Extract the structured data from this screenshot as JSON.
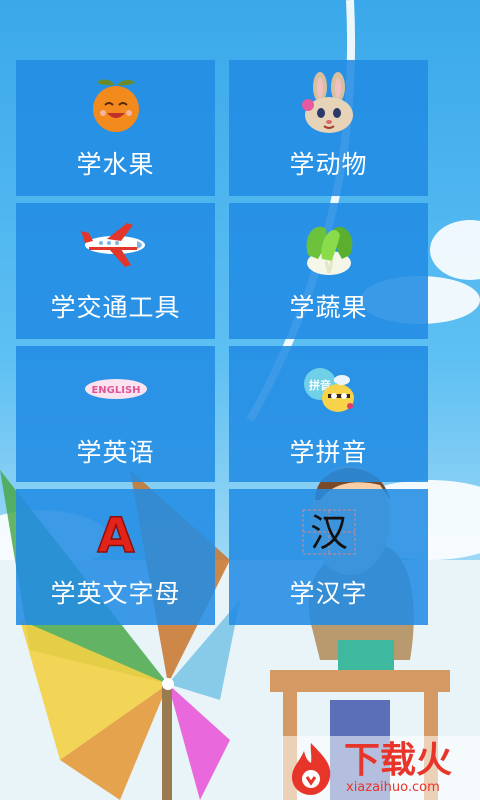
{
  "tiles": [
    {
      "label": "学水果",
      "icon": "orange-fruit-icon"
    },
    {
      "label": "学动物",
      "icon": "rabbit-icon"
    },
    {
      "label": "学交通工具",
      "icon": "airplane-icon"
    },
    {
      "label": "学蔬果",
      "icon": "cabbage-icon"
    },
    {
      "label": "学英语",
      "icon": "english-badge-icon"
    },
    {
      "label": "学拼音",
      "icon": "pinyin-bee-icon"
    },
    {
      "label": "学英文字母",
      "icon": "letter-a-icon"
    },
    {
      "label": "学汉字",
      "icon": "chinese-character-icon"
    }
  ],
  "icon_text": {
    "english": "ENGLISH",
    "pinyin": "拼音",
    "letter_a": "A",
    "hanzi": "汉"
  },
  "watermark": {
    "title": "下载火",
    "url": "xiazaihuo.com"
  },
  "colors": {
    "tile": "#228ce4",
    "sky_top": "#3aa8ea",
    "watermark": "#e8352a"
  }
}
